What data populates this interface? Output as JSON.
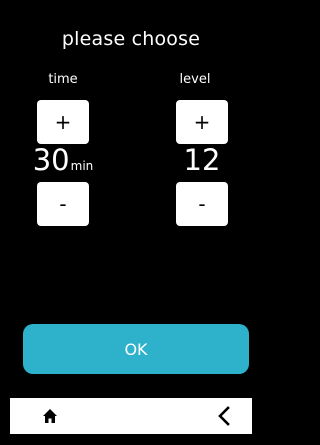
{
  "header": {
    "title": "please choose"
  },
  "time": {
    "label": "time",
    "plus": "+",
    "minus": "-",
    "value": "30",
    "unit": "min"
  },
  "level": {
    "label": "level",
    "plus": "+",
    "minus": "-",
    "value": "12"
  },
  "actions": {
    "ok_label": "OK"
  },
  "nav": {
    "home_icon": "home-icon",
    "back_icon": "chevron-left-icon"
  },
  "colors": {
    "background": "#000000",
    "accent": "#2eb2cc",
    "button_bg": "#ffffff"
  }
}
